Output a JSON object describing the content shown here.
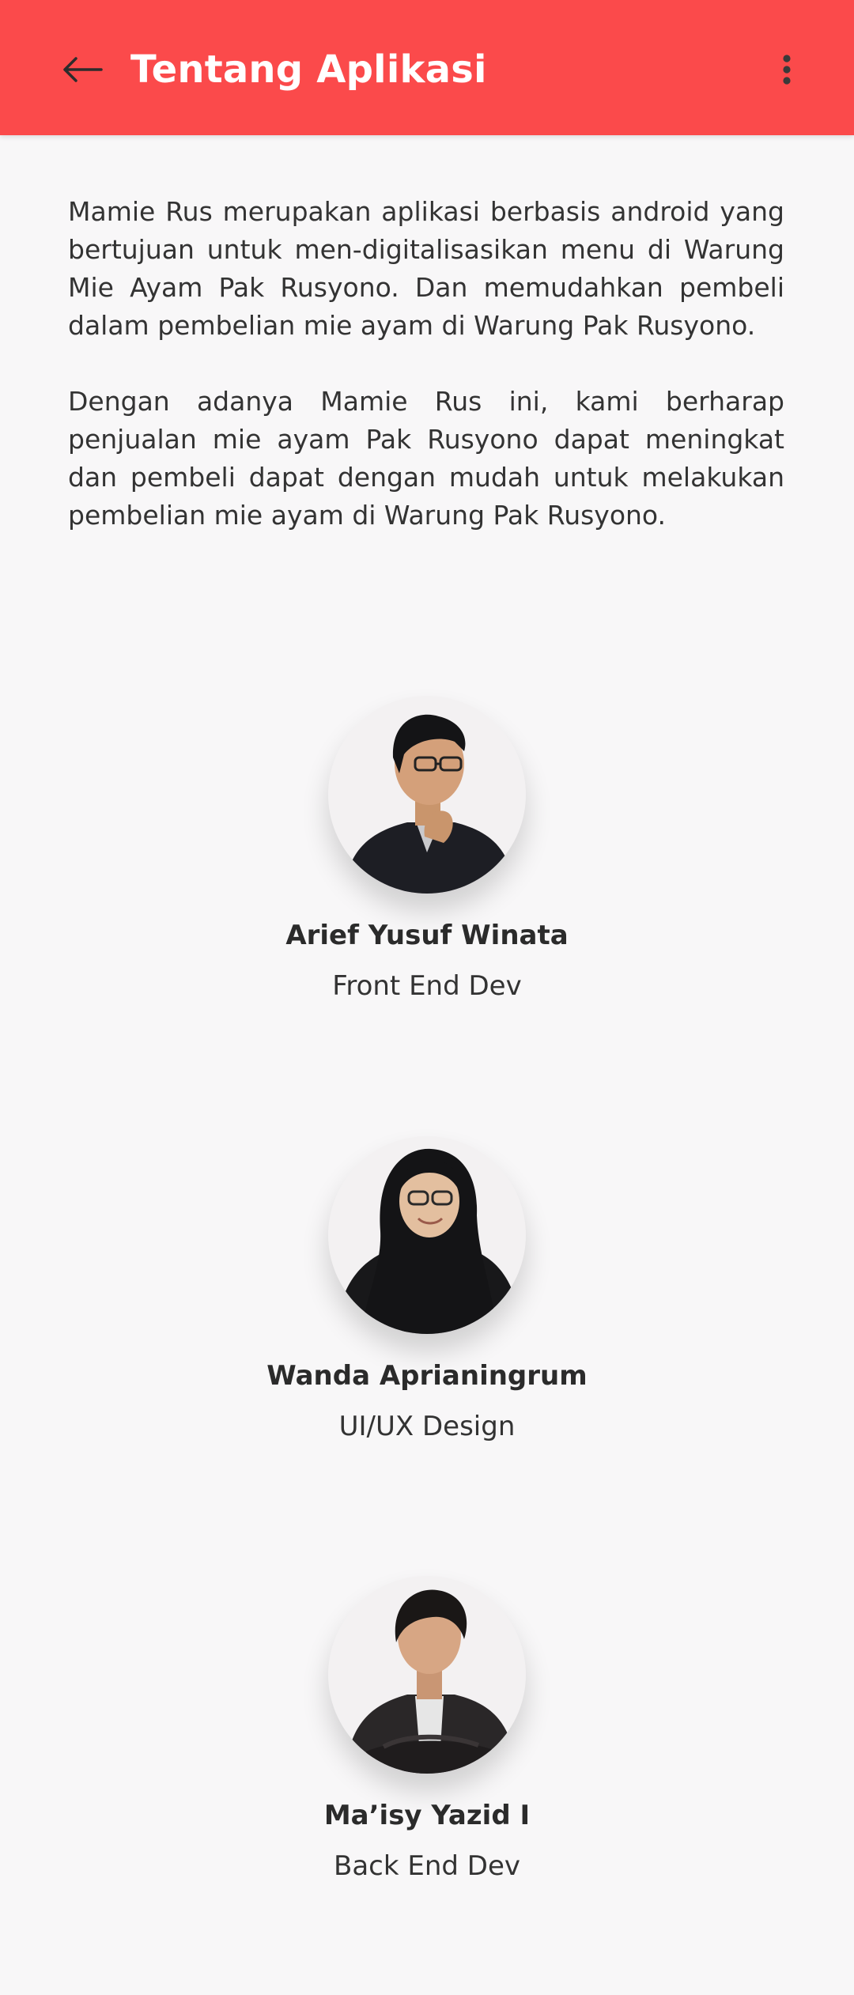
{
  "app_bar": {
    "title": "Tentang Aplikasi",
    "back_icon": "arrow-left-icon",
    "menu_icon": "more-vertical-icon",
    "background": "#fb4a4b"
  },
  "description": {
    "paragraph_1": "Mamie Rus merupakan aplikasi berbasis android yang bertujuan untuk men-digitalisasikan menu di Warung Mie Ayam Pak Rusyono. Dan memudahkan pembeli dalam pembelian mie ayam di Warung Pak Rusyono.",
    "paragraph_2": "Dengan adanya Mamie Rus ini, kami berharap penjualan mie ayam Pak Rusyono dapat meningkat dan pembeli dapat dengan mudah untuk melakukan pembelian mie ayam di Warung Pak Rusyono."
  },
  "team": [
    {
      "name": "Arief Yusuf Winata",
      "role": "Front End Dev",
      "photo": "member-photo"
    },
    {
      "name": "Wanda Aprianingrum",
      "role": "UI/UX Design",
      "photo": "member-photo"
    },
    {
      "name": "Ma’isy Yazid I",
      "role": "Back End Dev",
      "photo": "member-photo"
    }
  ]
}
